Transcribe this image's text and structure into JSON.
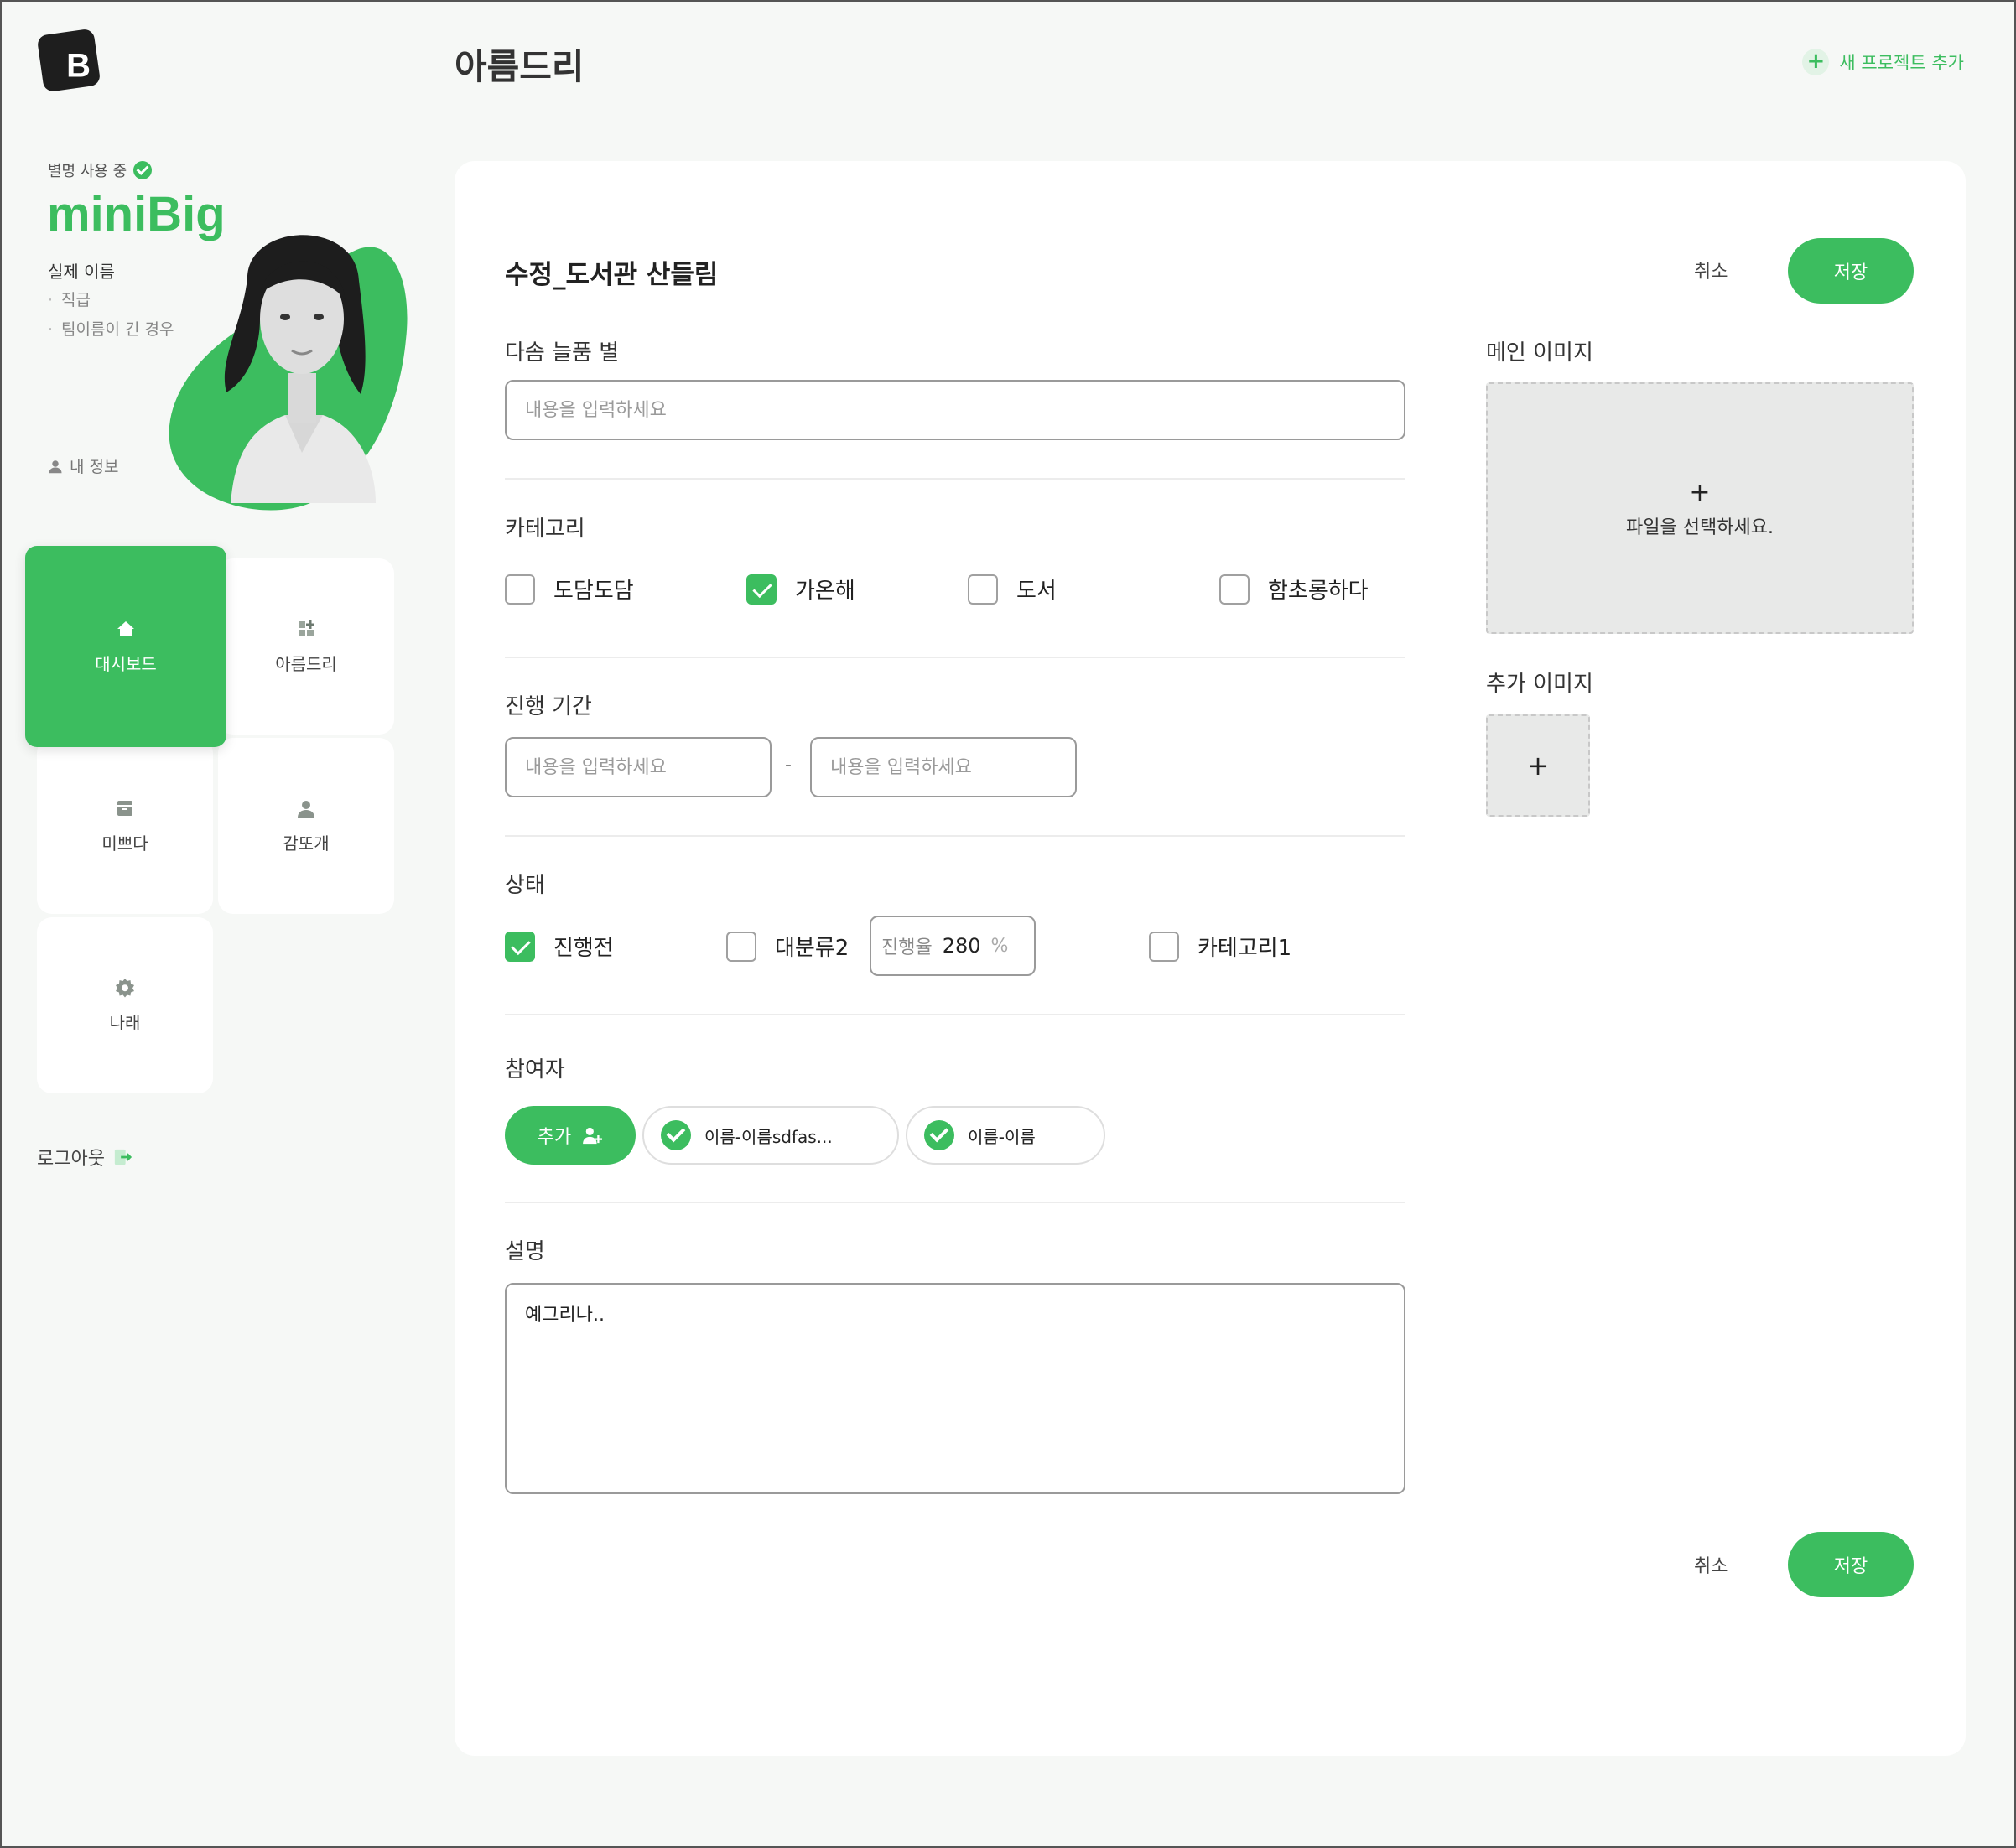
{
  "app": {
    "logo_letter": "B",
    "page_title": "아름드리",
    "new_project_label": "새 프로젝트 추가",
    "accent_color": "#3cbd5f"
  },
  "profile": {
    "nick_status": "별명 사용 중",
    "nickname": "miniBig",
    "real_name": "실제 이름",
    "position": "직급",
    "team": "팀이름이 긴 경우",
    "my_info": "내 정보"
  },
  "nav": {
    "items": [
      {
        "label": "대시보드",
        "icon": "home-icon",
        "active": true
      },
      {
        "label": "아름드리",
        "icon": "widgets-icon",
        "active": false
      },
      {
        "label": "미쁘다",
        "icon": "archive-icon",
        "active": false
      },
      {
        "label": "감또개",
        "icon": "person-icon",
        "active": false
      },
      {
        "label": "나래",
        "icon": "gear-icon",
        "active": false
      }
    ],
    "logout_label": "로그아웃"
  },
  "form": {
    "title": "수정_도서관 산들림",
    "cancel_label": "취소",
    "save_label": "저장",
    "name_field": {
      "label": "다솜 늘품 별",
      "placeholder": "내용을 입력하세요",
      "value": ""
    },
    "category": {
      "label": "카테고리",
      "options": [
        {
          "label": "도담도담",
          "checked": false
        },
        {
          "label": "가온해",
          "checked": true
        },
        {
          "label": "도서",
          "checked": false
        },
        {
          "label": "함초롱하다",
          "checked": false
        }
      ]
    },
    "period": {
      "label": "진행 기간",
      "start_placeholder": "내용을 입력하세요",
      "end_placeholder": "내용을 입력하세요",
      "separator": "-"
    },
    "status": {
      "label": "상태",
      "options": [
        {
          "label": "진행전",
          "checked": true
        },
        {
          "label": "대분류2",
          "checked": false
        },
        {
          "label": "카테고리1",
          "checked": false
        }
      ],
      "progress_label": "진행율",
      "progress_value": "280",
      "progress_unit": "%"
    },
    "participants": {
      "label": "참여자",
      "add_label": "추가",
      "people": [
        "이름-이름sdfas...",
        "이름-이름"
      ]
    },
    "description": {
      "label": "설명",
      "value": "예그리나.."
    },
    "main_image": {
      "label": "메인 이미지",
      "plus": "+",
      "prompt": "파일을 선택하세요."
    },
    "extra_image": {
      "label": "추가 이미지",
      "plus": "+"
    }
  }
}
